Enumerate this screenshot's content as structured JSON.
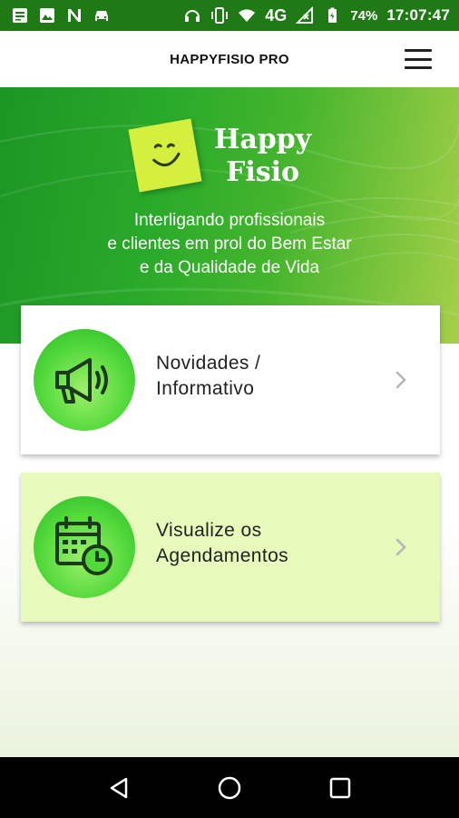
{
  "status_bar": {
    "network": "4G",
    "battery": "74%",
    "time": "17:07:47",
    "icons": [
      "notes-icon",
      "image-icon",
      "n-icon",
      "car-icon",
      "headphones-icon",
      "vibrate-icon",
      "wifi-icon",
      "signal-icon",
      "battery-icon"
    ]
  },
  "app_bar": {
    "title": "HAPPYFISIO PRO",
    "menu_icon": "hamburger-menu-icon"
  },
  "hero": {
    "logo_line1": "Happy",
    "logo_line2": "Fisio",
    "tagline_line1": "Interligando profissionais",
    "tagline_line2": "e clientes em prol do Bem Estar",
    "tagline_line3": "e da Qualidade de Vida"
  },
  "cards": [
    {
      "line1": "Novidades /",
      "line2": "Informativo",
      "icon": "megaphone-icon"
    },
    {
      "line1": "Visualize os",
      "line2": "Agendamentos",
      "icon": "calendar-clock-icon"
    }
  ],
  "nav_bar": {
    "icons": [
      "back-icon",
      "home-icon",
      "recents-icon"
    ]
  },
  "colors": {
    "status_bar": "#1f7a16",
    "hero_green": "#2aaa2a",
    "card_highlight": "#e7fabc",
    "icon_circle": "#52d93a",
    "icon_stroke": "#1c3a1c"
  }
}
